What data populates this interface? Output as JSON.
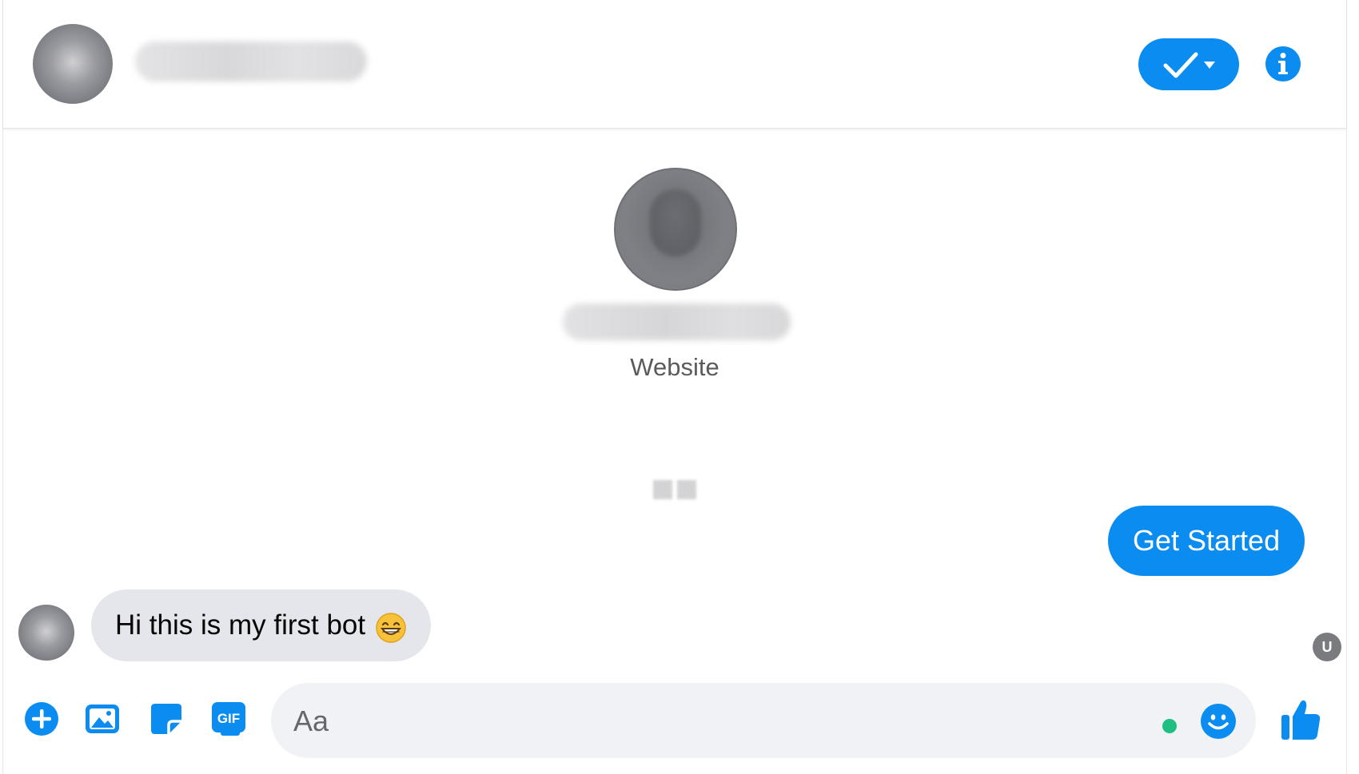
{
  "colors": {
    "accent": "#0a8cf0",
    "bubble_incoming": "#e4e6eb",
    "composer_background": "#f0f2f5",
    "online_dot": "#1fbf83"
  },
  "header": {
    "avatar_icon": "profile-avatar-blurred",
    "name": "",
    "done_button_icon": "checkmark-dropdown-icon",
    "info_icon": "info-icon"
  },
  "profile": {
    "name": "",
    "category": "Website"
  },
  "messages": [
    {
      "direction": "outgoing",
      "text": "Get Started"
    },
    {
      "direction": "incoming",
      "text": "Hi this is my first bot",
      "emoji": "grinning-face-with-smiling-eyes"
    }
  ],
  "seen_indicator": {
    "initial": "U"
  },
  "composer": {
    "placeholder": "Aa",
    "gif_label": "GIF",
    "icons": [
      "plus-icon",
      "photo-icon",
      "sticker-icon",
      "gif-icon",
      "emoji-icon",
      "thumbs-up-icon"
    ]
  }
}
